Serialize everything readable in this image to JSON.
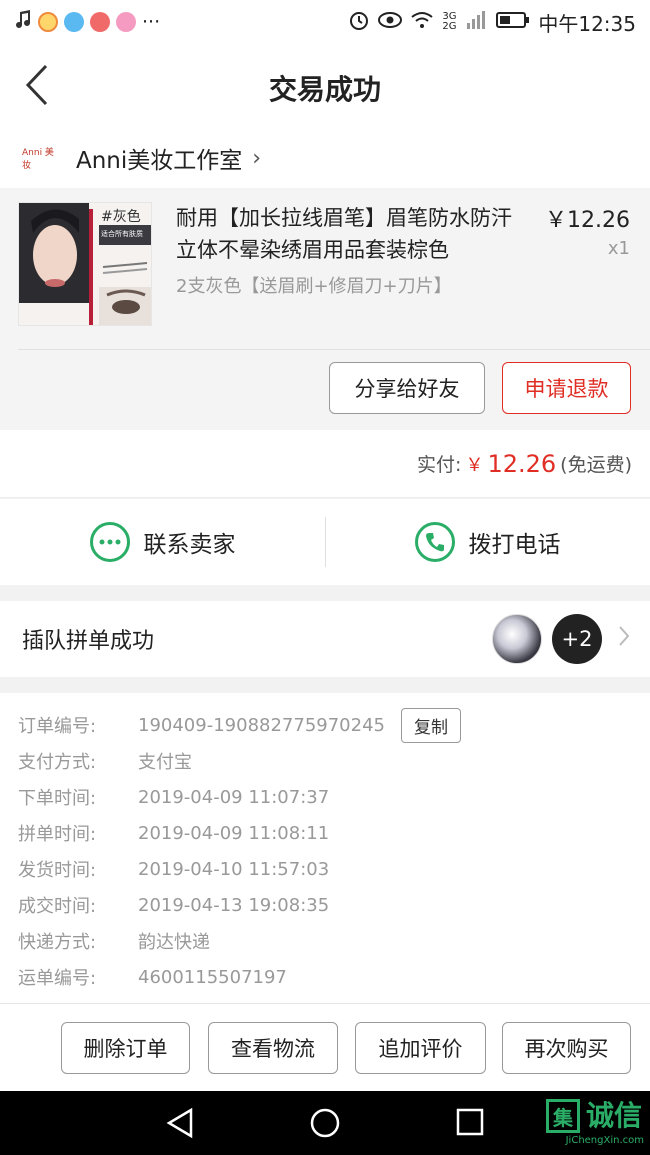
{
  "status_bar": {
    "time": "中午12:35",
    "network": "3G 2G",
    "icons": [
      "music-icon",
      "app-icon",
      "app-icon",
      "app-icon",
      "app-icon",
      "more-icon",
      "alarm-icon",
      "eye-icon",
      "wifi-icon",
      "signal-icon",
      "battery-icon"
    ],
    "more": "···"
  },
  "header": {
    "title": "交易成功",
    "back_icon": "chevron-left-icon"
  },
  "shop": {
    "logo_text": "Anni 美妆",
    "name": "Anni美妆工作室",
    "arrow": "›"
  },
  "product": {
    "image_tag": "#灰色",
    "image_caption": "适合所有肤质",
    "title": "耐用【加长拉线眉笔】眉笔防水防汗立体不晕染绣眉用品套装棕色",
    "price": "￥12.26",
    "qty": "x1",
    "spec": "2支灰色【送眉刷+修眉刀+刀片】",
    "share_label": "分享给好友",
    "refund_label": "申请退款"
  },
  "payment": {
    "label": "实付:",
    "currency": "￥",
    "amount": "12.26",
    "note": "(免运费)"
  },
  "contact": {
    "seller_label": "联系卖家",
    "phone_label": "拨打电话"
  },
  "group": {
    "label": "插队拼单成功",
    "extra": "+2"
  },
  "order": {
    "copy_label": "复制",
    "rows": [
      {
        "label": "订单编号:",
        "value": "190409-190882775970245"
      },
      {
        "label": "支付方式:",
        "value": "支付宝"
      },
      {
        "label": "下单时间:",
        "value": "2019-04-09 11:07:37"
      },
      {
        "label": "拼单时间:",
        "value": "2019-04-09 11:08:11"
      },
      {
        "label": "发货时间:",
        "value": "2019-04-10 11:57:03"
      },
      {
        "label": "成交时间:",
        "value": "2019-04-13 19:08:35"
      },
      {
        "label": "快递方式:",
        "value": "韵达快递"
      },
      {
        "label": "运单编号:",
        "value": "4600115507197"
      }
    ]
  },
  "actions": {
    "delete": "删除订单",
    "logistics": "查看物流",
    "review": "追加评价",
    "rebuy": "再次购买"
  },
  "watermark": {
    "mark": "集",
    "text": "诚信",
    "sub": "JiChengXin.com"
  },
  "colors": {
    "accent_red": "#e02e24",
    "wechat_green": "#2aae67"
  }
}
